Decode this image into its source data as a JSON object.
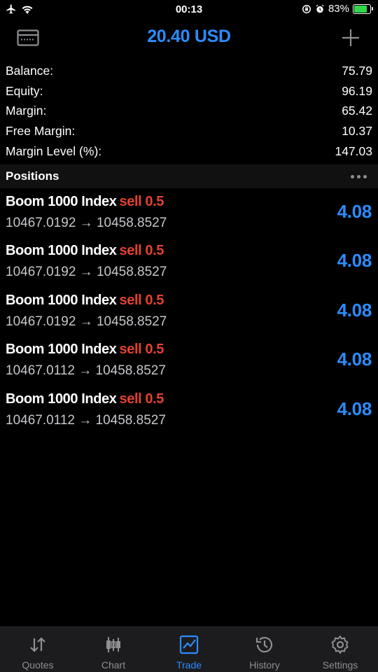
{
  "status": {
    "time": "00:13",
    "battery_percent": "83%",
    "battery_level": 0.83
  },
  "header": {
    "title": "20.40 USD",
    "left_icon": "card-icon",
    "right_icon": "plus-icon"
  },
  "summary": [
    {
      "label": "Balance:",
      "value": "75.79"
    },
    {
      "label": "Equity:",
      "value": "96.19"
    },
    {
      "label": "Margin:",
      "value": "65.42"
    },
    {
      "label": "Free Margin:",
      "value": "10.37"
    },
    {
      "label": "Margin Level (%):",
      "value": "147.03"
    }
  ],
  "positions": {
    "title": "Positions",
    "items": [
      {
        "symbol": "Boom 1000 Index",
        "side": "sell 0.5",
        "prices": "10467.0192 → 10458.8527",
        "profit": "4.08"
      },
      {
        "symbol": "Boom 1000 Index",
        "side": "sell 0.5",
        "prices": "10467.0192 → 10458.8527",
        "profit": "4.08"
      },
      {
        "symbol": "Boom 1000 Index",
        "side": "sell 0.5",
        "prices": "10467.0192 → 10458.8527",
        "profit": "4.08"
      },
      {
        "symbol": "Boom 1000 Index",
        "side": "sell 0.5",
        "prices": "10467.0112 → 10458.8527",
        "profit": "4.08"
      },
      {
        "symbol": "Boom 1000 Index",
        "side": "sell 0.5",
        "prices": "10467.0112 → 10458.8527",
        "profit": "4.08"
      }
    ]
  },
  "tabs": [
    {
      "label": "Quotes",
      "icon": "quotes-icon"
    },
    {
      "label": "Chart",
      "icon": "chart-icon"
    },
    {
      "label": "Trade",
      "icon": "trade-icon",
      "active": true
    },
    {
      "label": "History",
      "icon": "history-icon"
    },
    {
      "label": "Settings",
      "icon": "settings-icon"
    }
  ],
  "colors": {
    "accent": "#2b8cff",
    "sell": "#e5412f",
    "background": "#000000"
  }
}
